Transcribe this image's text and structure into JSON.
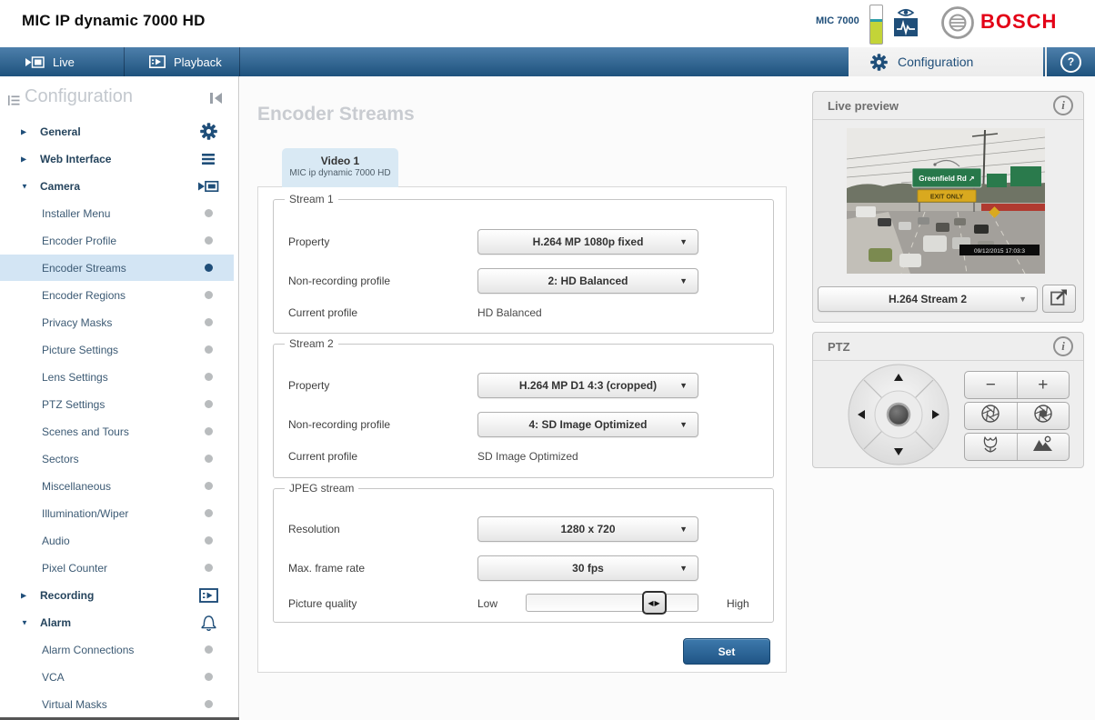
{
  "colors": {
    "accent": "#1f4e79",
    "brand_red": "#e30016",
    "nav_top": "#4d7fab",
    "nav_bottom": "#1e527d",
    "selected_bg": "#d3e5f4"
  },
  "icons": {
    "dropdown_arrow": "▼",
    "slider_handle": "◀▶",
    "tree_collapsed": "▶",
    "tree_expanded": "▼",
    "help_glyph": "?",
    "info_glyph": "i"
  },
  "header": {
    "title": "MIC IP dynamic 7000 HD",
    "device_label": "MIC 7000",
    "brand": "BOSCH"
  },
  "nav": {
    "live": "Live",
    "playback": "Playback",
    "configuration": "Configuration"
  },
  "sidebar": {
    "title": "Configuration",
    "items": [
      {
        "label": "General",
        "level": "top",
        "state": "collapsed",
        "icon": "gear-icon"
      },
      {
        "label": "Web Interface",
        "level": "top",
        "state": "collapsed",
        "icon": "menu-icon"
      },
      {
        "label": "Camera",
        "level": "top",
        "state": "expanded",
        "icon": "camera-icon"
      },
      {
        "label": "Installer Menu",
        "level": "sub",
        "icon": "dot"
      },
      {
        "label": "Encoder Profile",
        "level": "sub",
        "icon": "dot"
      },
      {
        "label": "Encoder Streams",
        "level": "sub",
        "icon": "dot",
        "selected": true
      },
      {
        "label": "Encoder Regions",
        "level": "sub",
        "icon": "dot"
      },
      {
        "label": "Privacy Masks",
        "level": "sub",
        "icon": "dot"
      },
      {
        "label": "Picture Settings",
        "level": "sub",
        "icon": "dot"
      },
      {
        "label": "Lens Settings",
        "level": "sub",
        "icon": "dot"
      },
      {
        "label": "PTZ Settings",
        "level": "sub",
        "icon": "dot"
      },
      {
        "label": "Scenes and Tours",
        "level": "sub",
        "icon": "dot"
      },
      {
        "label": "Sectors",
        "level": "sub",
        "icon": "dot"
      },
      {
        "label": "Miscellaneous",
        "level": "sub",
        "icon": "dot"
      },
      {
        "label": "Illumination/Wiper",
        "level": "sub",
        "icon": "dot"
      },
      {
        "label": "Audio",
        "level": "sub",
        "icon": "dot"
      },
      {
        "label": "Pixel Counter",
        "level": "sub",
        "icon": "dot"
      },
      {
        "label": "Recording",
        "level": "top",
        "state": "collapsed",
        "icon": "recording-icon"
      },
      {
        "label": "Alarm",
        "level": "top",
        "state": "expanded",
        "icon": "bell-icon"
      },
      {
        "label": "Alarm Connections",
        "level": "sub",
        "icon": "dot"
      },
      {
        "label": "VCA",
        "level": "sub",
        "icon": "dot"
      },
      {
        "label": "Virtual Masks",
        "level": "sub",
        "icon": "dot"
      }
    ]
  },
  "main": {
    "page_title": "Encoder Streams",
    "video_tab": {
      "title": "Video 1",
      "subtitle": "MIC ip dynamic 7000 HD"
    },
    "stream1": {
      "legend": "Stream 1",
      "property_label": "Property",
      "property_value": "H.264 MP 1080p fixed",
      "profile_label": "Non-recording profile",
      "profile_value": "2: HD Balanced",
      "current_label": "Current profile",
      "current_value": "HD Balanced"
    },
    "stream2": {
      "legend": "Stream 2",
      "property_label": "Property",
      "property_value": "H.264 MP D1 4:3 (cropped)",
      "profile_label": "Non-recording profile",
      "profile_value": "4: SD Image Optimized",
      "current_label": "Current profile",
      "current_value": "SD Image Optimized"
    },
    "jpeg": {
      "legend": "JPEG stream",
      "resolution_label": "Resolution",
      "resolution_value": "1280 x 720",
      "framerate_label": "Max. frame rate",
      "framerate_value": "30 fps",
      "quality_label": "Picture quality",
      "low_label": "Low",
      "high_label": "High",
      "quality_percent": 78
    },
    "set_label": "Set"
  },
  "preview": {
    "title": "Live preview",
    "stream_select": "H.264 Stream 2",
    "sign_text": "Greenfield Rd ↗",
    "exit_text": "EXIT ONLY",
    "timestamp": "09/12/2015 17:03:3"
  },
  "ptz": {
    "title": "PTZ",
    "zoom_out": "−",
    "zoom_in": "+"
  }
}
